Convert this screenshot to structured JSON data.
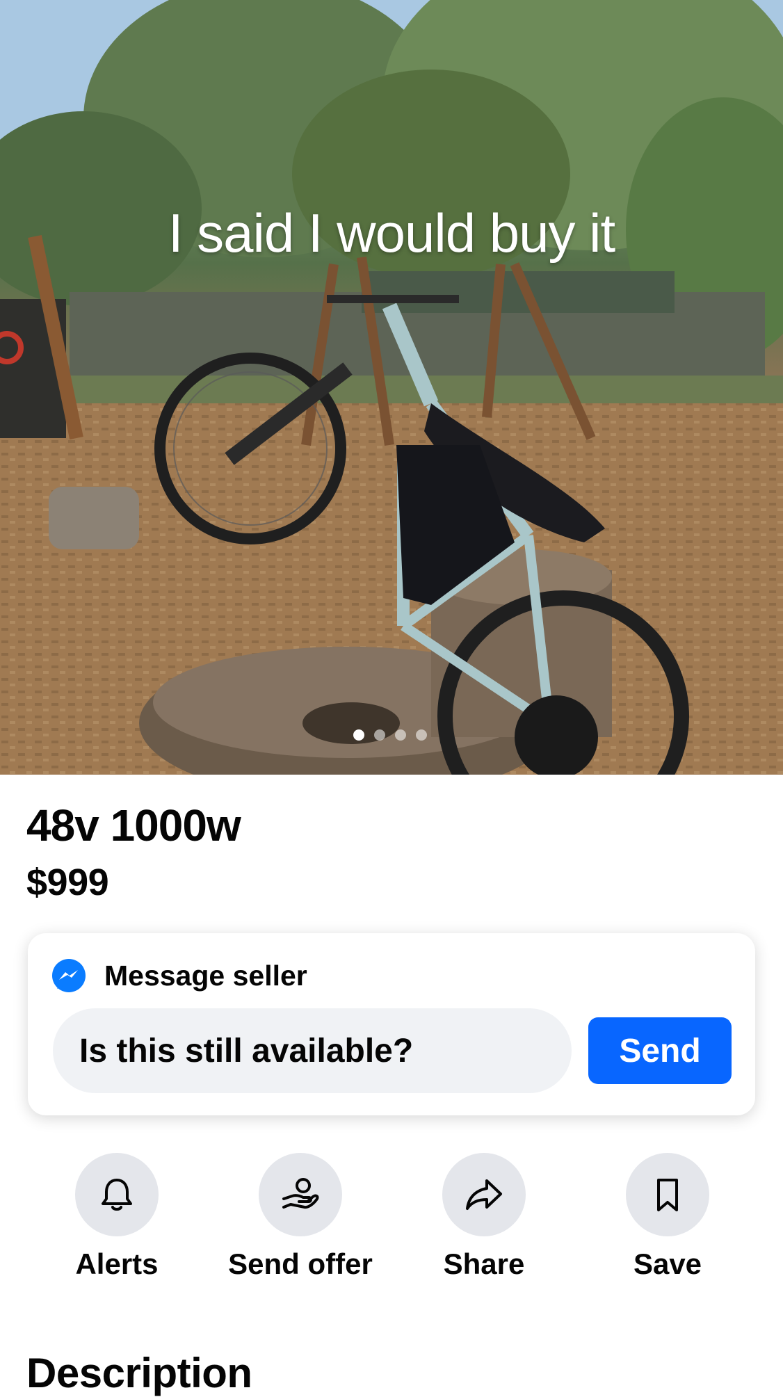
{
  "listing": {
    "photo_caption": "I said I would buy it",
    "photo_count": 4,
    "active_photo": 1,
    "title": "48v 1000w",
    "price": "$999"
  },
  "message_card": {
    "header_label": "Message seller",
    "header_icon": "messenger-icon",
    "input_value": "Is this still available?",
    "send_label": "Send",
    "accent_color": "#0866ff"
  },
  "actions": [
    {
      "label": "Alerts",
      "icon": "bell-icon"
    },
    {
      "label": "Send offer",
      "icon": "offer-hand-icon"
    },
    {
      "label": "Share",
      "icon": "share-arrow-icon"
    },
    {
      "label": "Save",
      "icon": "bookmark-icon"
    }
  ],
  "description": {
    "heading": "Description"
  }
}
